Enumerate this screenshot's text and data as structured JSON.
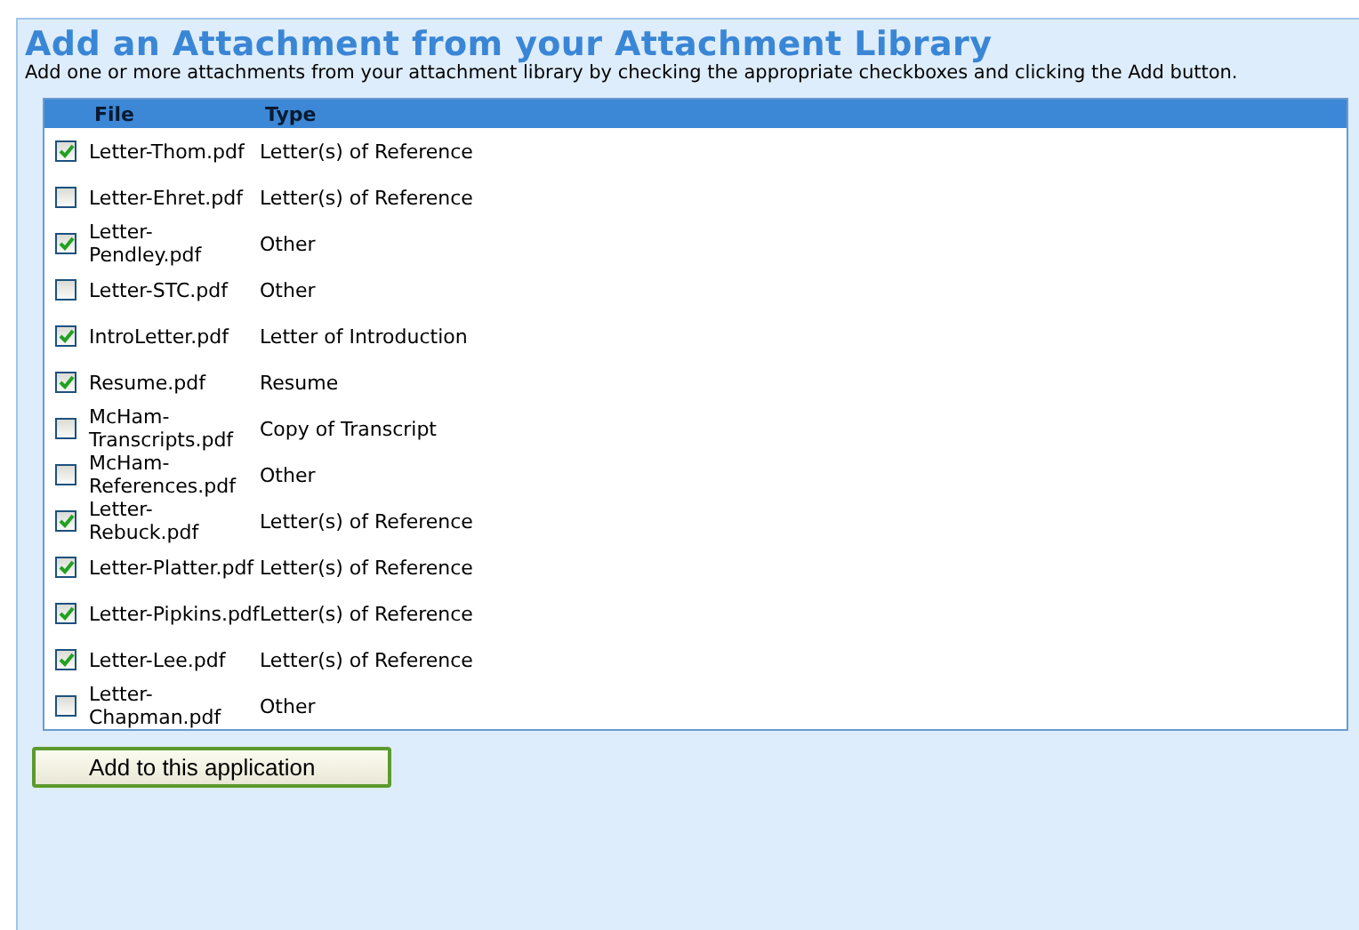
{
  "title": "Add an Attachment from your Attachment Library",
  "instructions": "Add one or more attachments from your attachment library by checking the appropriate checkboxes and clicking the Add button.",
  "table": {
    "columns": [
      "File",
      "Type"
    ],
    "rows": [
      {
        "file": "Letter-Thom.pdf",
        "type": "Letter(s) of Reference",
        "checked": true
      },
      {
        "file": "Letter-Ehret.pdf",
        "type": "Letter(s) of Reference",
        "checked": false
      },
      {
        "file": "Letter-Pendley.pdf",
        "type": "Other",
        "checked": true
      },
      {
        "file": "Letter-STC.pdf",
        "type": "Other",
        "checked": false
      },
      {
        "file": "IntroLetter.pdf",
        "type": "Letter of Introduction",
        "checked": true
      },
      {
        "file": "Resume.pdf",
        "type": "Resume",
        "checked": true
      },
      {
        "file": "McHam-Transcripts.pdf",
        "type": "Copy of Transcript",
        "checked": false
      },
      {
        "file": "McHam-References.pdf",
        "type": "Other",
        "checked": false
      },
      {
        "file": "Letter-Rebuck.pdf",
        "type": "Letter(s) of Reference",
        "checked": true
      },
      {
        "file": "Letter-Platter.pdf",
        "type": "Letter(s) of Reference",
        "checked": true
      },
      {
        "file": "Letter-Pipkins.pdf",
        "type": "Letter(s) of Reference",
        "checked": true
      },
      {
        "file": "Letter-Lee.pdf",
        "type": "Letter(s) of Reference",
        "checked": true
      },
      {
        "file": "Letter-Chapman.pdf",
        "type": "Other",
        "checked": false
      }
    ]
  },
  "button": "Add to this application"
}
